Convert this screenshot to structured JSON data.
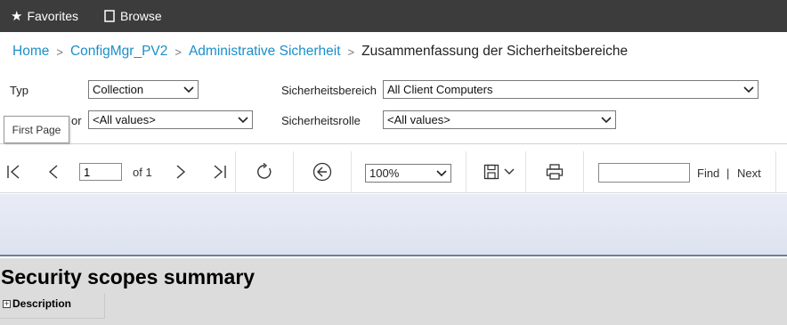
{
  "topbar": {
    "favorites_label": "Favorites",
    "browse_label": "Browse"
  },
  "breadcrumb": {
    "items": [
      "Home",
      "ConfigMgr_PV2",
      "Administrative Sicherheit"
    ],
    "current": "Zusammenfassung der Sicherheitsbereiche"
  },
  "params": {
    "typ_label": "Typ",
    "typ_value": "Collection",
    "row2_label_partial": "or",
    "row2_value": "<All values>",
    "sicherheitsbereich_label": "Sicherheitsbereich",
    "sicherheitsbereich_value": "All Client Computers",
    "sicherheitsrolle_label": "Sicherheitsrolle",
    "sicherheitsrolle_value": "<All values>"
  },
  "tooltip": {
    "text": "First Page"
  },
  "toolbar": {
    "page_value": "1",
    "of_text": "of 1",
    "zoom_value": "100%",
    "find_label": "Find",
    "divider": "|",
    "next_label": "Next"
  },
  "report": {
    "title": "Security scopes summary",
    "description_label": "Description"
  },
  "colors": {
    "topbar_bg": "#3c3c3c",
    "link": "#1a8fc9",
    "report_bg": "#dcdcdc"
  }
}
